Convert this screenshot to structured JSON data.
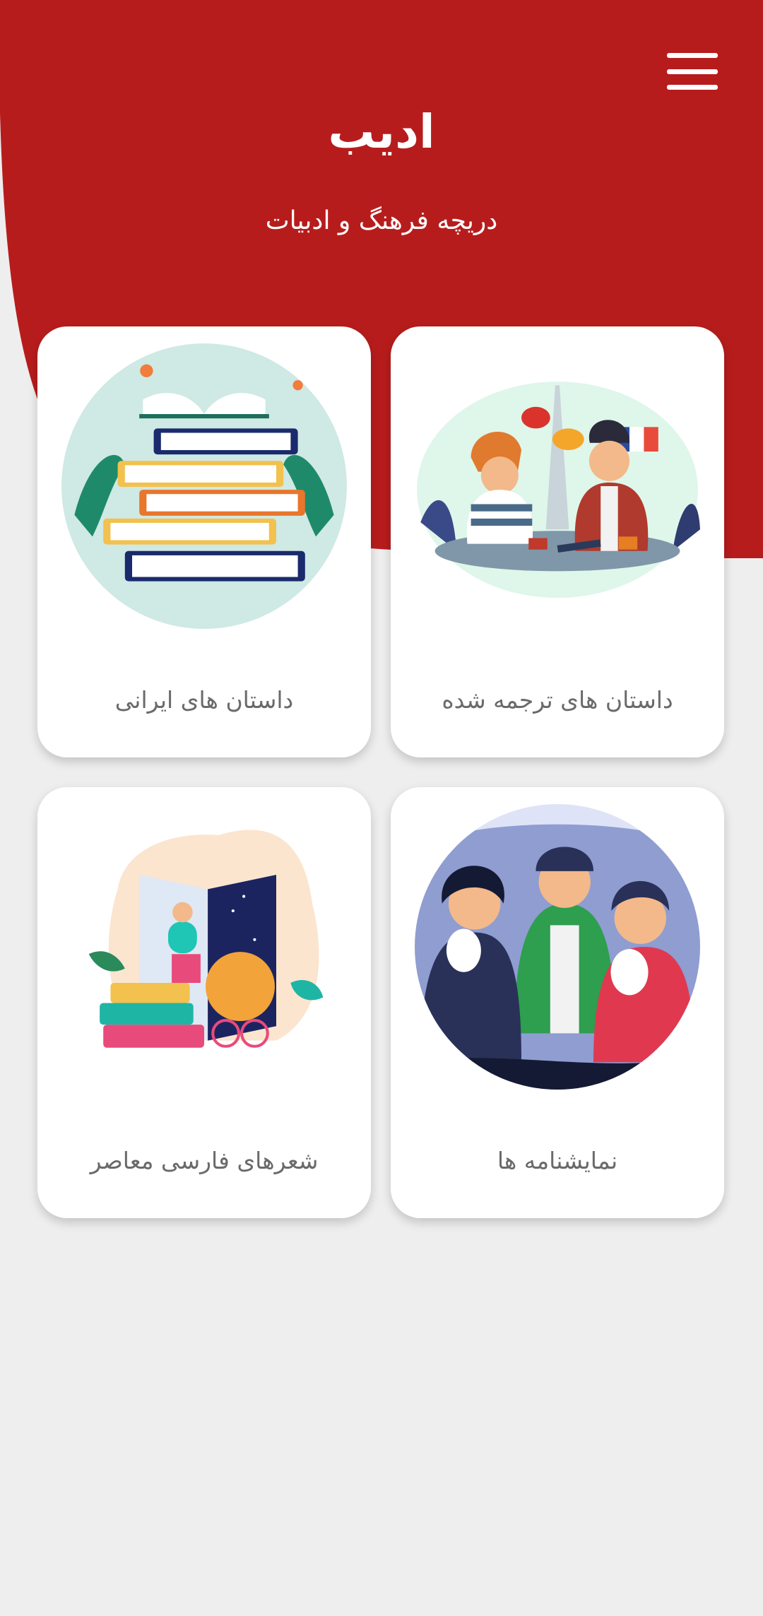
{
  "header": {
    "title": "ادیب",
    "subtitle": "دریچه فرهنگ و ادبیات",
    "menu_icon": "hamburger-menu-icon",
    "background_color": "#b71c1c"
  },
  "categories": [
    {
      "label": "داستان های ترجمه شده",
      "illustration": "cafe-conversation-illustration"
    },
    {
      "label": "داستان های ایرانی",
      "illustration": "book-stack-illustration"
    },
    {
      "label": "نمایشنامه ها",
      "illustration": "theater-masks-illustration"
    },
    {
      "label": "شعرهای فارسی معاصر",
      "illustration": "open-book-reader-illustration"
    }
  ],
  "colors": {
    "background": "#eeeeee",
    "card": "#ffffff",
    "label": "#6a6a6a"
  }
}
